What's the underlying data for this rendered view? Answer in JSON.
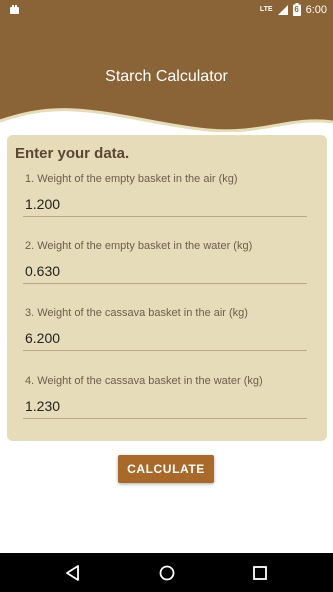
{
  "status_bar": {
    "network": "LTE",
    "battery": "6",
    "time": "6:00"
  },
  "header": {
    "title": "Starch Calculator"
  },
  "form": {
    "title": "Enter your data.",
    "fields": [
      {
        "label": "1. Weight of the empty basket in the air (kg)",
        "value": "1.200"
      },
      {
        "label": "2. Weight of the empty basket in the water (kg)",
        "value": "0.630"
      },
      {
        "label": "3. Weight of the cassava basket in the air (kg)",
        "value": "6.200"
      },
      {
        "label": "4. Weight of the cassava basket in the water (kg)",
        "value": "1.230"
      }
    ],
    "button_label": "CALCULATE"
  },
  "colors": {
    "primary": "#8a6437",
    "card": "#e6dcb9",
    "button": "#a8692a"
  },
  "icons": {
    "status_left": "notification-icon",
    "signal": "signal-icon",
    "battery": "battery-icon",
    "back": "back-icon",
    "home": "home-icon",
    "recents": "recents-icon"
  }
}
